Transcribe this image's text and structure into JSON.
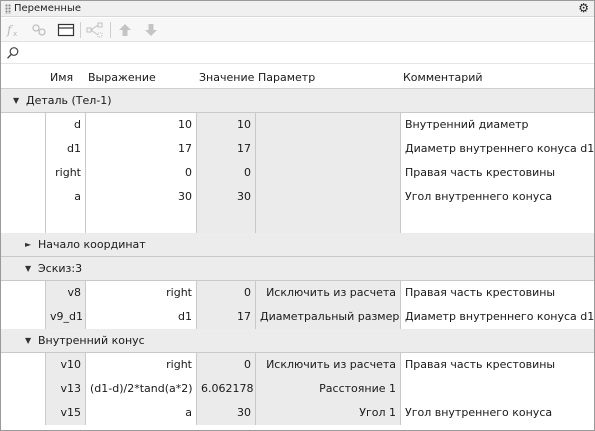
{
  "window": {
    "title": "Переменные"
  },
  "icons": {
    "gear": "gear-icon",
    "fx": "fx-icon",
    "link": "link-icon",
    "table": "table-icon",
    "diagram": "diagram-icon",
    "up": "arrow-up-icon",
    "down": "arrow-down-icon",
    "search": "search-icon"
  },
  "search": {
    "value": "",
    "placeholder": ""
  },
  "headers": {
    "name": "Имя",
    "expression": "Выражение",
    "value": "Значение",
    "parameter": "Параметр",
    "comment": "Комментарий"
  },
  "groups": {
    "part": {
      "label": "Деталь (Тел-1)",
      "expanded": true
    },
    "origin": {
      "label": "Начало координат",
      "expanded": false
    },
    "sketch": {
      "label": "Эскиз:3",
      "expanded": true
    },
    "inner_cone": {
      "label": "Внутренний конус",
      "expanded": true
    }
  },
  "part_rows": [
    {
      "name": "d",
      "expression": "10",
      "value": "10",
      "parameter": "",
      "comment": "Внутренний диаметр"
    },
    {
      "name": "d1",
      "expression": "17",
      "value": "17",
      "parameter": "",
      "comment": "Диаметр внутреннего конуса d1"
    },
    {
      "name": "right",
      "expression": "0",
      "value": "0",
      "parameter": "",
      "comment": "Правая часть крестовины"
    },
    {
      "name": "a",
      "expression": "30",
      "value": "30",
      "parameter": "",
      "comment": "Угол внутреннего конуса"
    },
    {
      "name": "",
      "expression": "",
      "value": "",
      "parameter": "",
      "comment": ""
    }
  ],
  "sketch_rows": [
    {
      "name": "v8",
      "expression": "right",
      "value": "0",
      "parameter": "Исключить из расчета",
      "comment": "Правая часть крестовины"
    },
    {
      "name": "v9_d1",
      "expression": "d1",
      "value": "17",
      "parameter": "Диаметральный размер",
      "comment": "Диаметр внутреннего конуса d1"
    }
  ],
  "cone_rows": [
    {
      "name": "v10",
      "expression": "right",
      "value": "0",
      "parameter": "Исключить из расчета",
      "comment": "Правая часть крестовины"
    },
    {
      "name": "v13",
      "expression": "(d1-d)/2*tand(a*2)",
      "value": "6.062178",
      "parameter": "Расстояние 1",
      "comment": ""
    },
    {
      "name": "v15",
      "expression": "a",
      "value": "30",
      "parameter": "Угол 1",
      "comment": "Угол внутреннего конуса"
    }
  ]
}
